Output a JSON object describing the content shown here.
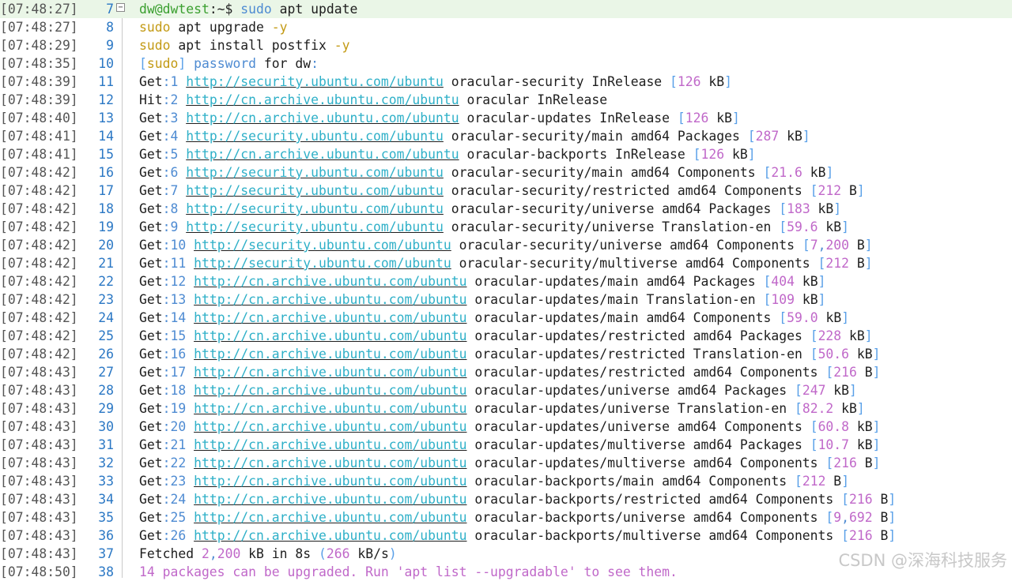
{
  "watermark": "CSDN @深海科技服务",
  "fold_icon": "minus-box-icon",
  "lines": [
    {
      "ts": "[07:48:27]",
      "n": "7",
      "active": true,
      "segs": [
        [
          "dw@dwtest",
          "green"
        ],
        [
          ":~$ ",
          "dark"
        ],
        [
          "sudo",
          "blue"
        ],
        [
          " apt update",
          "dark"
        ]
      ]
    },
    {
      "ts": "[07:48:27]",
      "n": "8",
      "segs": [
        [
          "sudo",
          "yellow"
        ],
        [
          " apt upgrade ",
          "dark"
        ],
        [
          "-y",
          "yellow"
        ]
      ]
    },
    {
      "ts": "[07:48:29]",
      "n": "9",
      "segs": [
        [
          "sudo",
          "yellow"
        ],
        [
          " apt install postfix ",
          "dark"
        ],
        [
          "-y",
          "yellow"
        ]
      ]
    },
    {
      "ts": "[07:48:35]",
      "n": "10",
      "segs": [
        [
          "[",
          "bracket"
        ],
        [
          "sudo",
          "yellow"
        ],
        [
          "] ",
          "bracket"
        ],
        [
          "password",
          "blue"
        ],
        [
          " for dw",
          "dark"
        ],
        [
          ":",
          "blue"
        ]
      ]
    },
    {
      "ts": "[07:48:39]",
      "n": "11",
      "segs": [
        [
          "Get",
          "dark"
        ],
        [
          ":1 ",
          "blue"
        ],
        [
          "http://security.ubuntu.com/ubuntu",
          "url"
        ],
        [
          " oracular-security InRelease ",
          "dark"
        ],
        [
          "[",
          "bracket"
        ],
        [
          "126",
          "num"
        ],
        [
          " kB",
          "dark"
        ],
        [
          "]",
          "bracket"
        ]
      ]
    },
    {
      "ts": "[07:48:39]",
      "n": "12",
      "segs": [
        [
          "Hit",
          "dark"
        ],
        [
          ":2 ",
          "blue"
        ],
        [
          "http://cn.archive.ubuntu.com/ubuntu",
          "url"
        ],
        [
          " oracular InRelease",
          "dark"
        ]
      ]
    },
    {
      "ts": "[07:48:40]",
      "n": "13",
      "segs": [
        [
          "Get",
          "dark"
        ],
        [
          ":3 ",
          "blue"
        ],
        [
          "http://cn.archive.ubuntu.com/ubuntu",
          "url"
        ],
        [
          " oracular-updates InRelease ",
          "dark"
        ],
        [
          "[",
          "bracket"
        ],
        [
          "126",
          "num"
        ],
        [
          " kB",
          "dark"
        ],
        [
          "]",
          "bracket"
        ]
      ]
    },
    {
      "ts": "[07:48:41]",
      "n": "14",
      "segs": [
        [
          "Get",
          "dark"
        ],
        [
          ":4 ",
          "blue"
        ],
        [
          "http://security.ubuntu.com/ubuntu",
          "url"
        ],
        [
          " oracular-security/main amd64 Packages ",
          "dark"
        ],
        [
          "[",
          "bracket"
        ],
        [
          "287",
          "num"
        ],
        [
          " kB",
          "dark"
        ],
        [
          "]",
          "bracket"
        ]
      ]
    },
    {
      "ts": "[07:48:41]",
      "n": "15",
      "segs": [
        [
          "Get",
          "dark"
        ],
        [
          ":5 ",
          "blue"
        ],
        [
          "http://cn.archive.ubuntu.com/ubuntu",
          "url"
        ],
        [
          " oracular-backports InRelease ",
          "dark"
        ],
        [
          "[",
          "bracket"
        ],
        [
          "126",
          "num"
        ],
        [
          " kB",
          "dark"
        ],
        [
          "]",
          "bracket"
        ]
      ]
    },
    {
      "ts": "[07:48:42]",
      "n": "16",
      "segs": [
        [
          "Get",
          "dark"
        ],
        [
          ":6 ",
          "blue"
        ],
        [
          "http://security.ubuntu.com/ubuntu",
          "url"
        ],
        [
          " oracular-security/main amd64 Components ",
          "dark"
        ],
        [
          "[",
          "bracket"
        ],
        [
          "21.6",
          "num"
        ],
        [
          " kB",
          "dark"
        ],
        [
          "]",
          "bracket"
        ]
      ]
    },
    {
      "ts": "[07:48:42]",
      "n": "17",
      "segs": [
        [
          "Get",
          "dark"
        ],
        [
          ":7 ",
          "blue"
        ],
        [
          "http://security.ubuntu.com/ubuntu",
          "url"
        ],
        [
          " oracular-security/restricted amd64 Components ",
          "dark"
        ],
        [
          "[",
          "bracket"
        ],
        [
          "212",
          "num"
        ],
        [
          " B",
          "dark"
        ],
        [
          "]",
          "bracket"
        ]
      ]
    },
    {
      "ts": "[07:48:42]",
      "n": "18",
      "segs": [
        [
          "Get",
          "dark"
        ],
        [
          ":8 ",
          "blue"
        ],
        [
          "http://security.ubuntu.com/ubuntu",
          "url"
        ],
        [
          " oracular-security/universe amd64 Packages ",
          "dark"
        ],
        [
          "[",
          "bracket"
        ],
        [
          "183",
          "num"
        ],
        [
          " kB",
          "dark"
        ],
        [
          "]",
          "bracket"
        ]
      ]
    },
    {
      "ts": "[07:48:42]",
      "n": "19",
      "segs": [
        [
          "Get",
          "dark"
        ],
        [
          ":9 ",
          "blue"
        ],
        [
          "http://security.ubuntu.com/ubuntu",
          "url"
        ],
        [
          " oracular-security/universe Translation-en ",
          "dark"
        ],
        [
          "[",
          "bracket"
        ],
        [
          "59.6",
          "num"
        ],
        [
          " kB",
          "dark"
        ],
        [
          "]",
          "bracket"
        ]
      ]
    },
    {
      "ts": "[07:48:42]",
      "n": "20",
      "segs": [
        [
          "Get",
          "dark"
        ],
        [
          ":10 ",
          "blue"
        ],
        [
          "http://security.ubuntu.com/ubuntu",
          "url"
        ],
        [
          " oracular-security/universe amd64 Components ",
          "dark"
        ],
        [
          "[",
          "bracket"
        ],
        [
          "7",
          "num"
        ],
        [
          ",",
          "blue"
        ],
        [
          "200",
          "num"
        ],
        [
          " B",
          "dark"
        ],
        [
          "]",
          "bracket"
        ]
      ]
    },
    {
      "ts": "[07:48:42]",
      "n": "21",
      "segs": [
        [
          "Get",
          "dark"
        ],
        [
          ":11 ",
          "blue"
        ],
        [
          "http://security.ubuntu.com/ubuntu",
          "url"
        ],
        [
          " oracular-security/multiverse amd64 Components ",
          "dark"
        ],
        [
          "[",
          "bracket"
        ],
        [
          "212",
          "num"
        ],
        [
          " B",
          "dark"
        ],
        [
          "]",
          "bracket"
        ]
      ]
    },
    {
      "ts": "[07:48:42]",
      "n": "22",
      "segs": [
        [
          "Get",
          "dark"
        ],
        [
          ":12 ",
          "blue"
        ],
        [
          "http://cn.archive.ubuntu.com/ubuntu",
          "url"
        ],
        [
          " oracular-updates/main amd64 Packages ",
          "dark"
        ],
        [
          "[",
          "bracket"
        ],
        [
          "404",
          "num"
        ],
        [
          " kB",
          "dark"
        ],
        [
          "]",
          "bracket"
        ]
      ]
    },
    {
      "ts": "[07:48:42]",
      "n": "23",
      "segs": [
        [
          "Get",
          "dark"
        ],
        [
          ":13 ",
          "blue"
        ],
        [
          "http://cn.archive.ubuntu.com/ubuntu",
          "url"
        ],
        [
          " oracular-updates/main Translation-en ",
          "dark"
        ],
        [
          "[",
          "bracket"
        ],
        [
          "109",
          "num"
        ],
        [
          " kB",
          "dark"
        ],
        [
          "]",
          "bracket"
        ]
      ]
    },
    {
      "ts": "[07:48:42]",
      "n": "24",
      "segs": [
        [
          "Get",
          "dark"
        ],
        [
          ":14 ",
          "blue"
        ],
        [
          "http://cn.archive.ubuntu.com/ubuntu",
          "url"
        ],
        [
          " oracular-updates/main amd64 Components ",
          "dark"
        ],
        [
          "[",
          "bracket"
        ],
        [
          "59.0",
          "num"
        ],
        [
          " kB",
          "dark"
        ],
        [
          "]",
          "bracket"
        ]
      ]
    },
    {
      "ts": "[07:48:42]",
      "n": "25",
      "segs": [
        [
          "Get",
          "dark"
        ],
        [
          ":15 ",
          "blue"
        ],
        [
          "http://cn.archive.ubuntu.com/ubuntu",
          "url"
        ],
        [
          " oracular-updates/restricted amd64 Packages ",
          "dark"
        ],
        [
          "[",
          "bracket"
        ],
        [
          "228",
          "num"
        ],
        [
          " kB",
          "dark"
        ],
        [
          "]",
          "bracket"
        ]
      ]
    },
    {
      "ts": "[07:48:42]",
      "n": "26",
      "segs": [
        [
          "Get",
          "dark"
        ],
        [
          ":16 ",
          "blue"
        ],
        [
          "http://cn.archive.ubuntu.com/ubuntu",
          "url"
        ],
        [
          " oracular-updates/restricted Translation-en ",
          "dark"
        ],
        [
          "[",
          "bracket"
        ],
        [
          "50.6",
          "num"
        ],
        [
          " kB",
          "dark"
        ],
        [
          "]",
          "bracket"
        ]
      ]
    },
    {
      "ts": "[07:48:43]",
      "n": "27",
      "segs": [
        [
          "Get",
          "dark"
        ],
        [
          ":17 ",
          "blue"
        ],
        [
          "http://cn.archive.ubuntu.com/ubuntu",
          "url"
        ],
        [
          " oracular-updates/restricted amd64 Components ",
          "dark"
        ],
        [
          "[",
          "bracket"
        ],
        [
          "216",
          "num"
        ],
        [
          " B",
          "dark"
        ],
        [
          "]",
          "bracket"
        ]
      ]
    },
    {
      "ts": "[07:48:43]",
      "n": "28",
      "segs": [
        [
          "Get",
          "dark"
        ],
        [
          ":18 ",
          "blue"
        ],
        [
          "http://cn.archive.ubuntu.com/ubuntu",
          "url"
        ],
        [
          " oracular-updates/universe amd64 Packages ",
          "dark"
        ],
        [
          "[",
          "bracket"
        ],
        [
          "247",
          "num"
        ],
        [
          " kB",
          "dark"
        ],
        [
          "]",
          "bracket"
        ]
      ]
    },
    {
      "ts": "[07:48:43]",
      "n": "29",
      "segs": [
        [
          "Get",
          "dark"
        ],
        [
          ":19 ",
          "blue"
        ],
        [
          "http://cn.archive.ubuntu.com/ubuntu",
          "url"
        ],
        [
          " oracular-updates/universe Translation-en ",
          "dark"
        ],
        [
          "[",
          "bracket"
        ],
        [
          "82.2",
          "num"
        ],
        [
          " kB",
          "dark"
        ],
        [
          "]",
          "bracket"
        ]
      ]
    },
    {
      "ts": "[07:48:43]",
      "n": "30",
      "segs": [
        [
          "Get",
          "dark"
        ],
        [
          ":20 ",
          "blue"
        ],
        [
          "http://cn.archive.ubuntu.com/ubuntu",
          "url"
        ],
        [
          " oracular-updates/universe amd64 Components ",
          "dark"
        ],
        [
          "[",
          "bracket"
        ],
        [
          "60.8",
          "num"
        ],
        [
          " kB",
          "dark"
        ],
        [
          "]",
          "bracket"
        ]
      ]
    },
    {
      "ts": "[07:48:43]",
      "n": "31",
      "segs": [
        [
          "Get",
          "dark"
        ],
        [
          ":21 ",
          "blue"
        ],
        [
          "http://cn.archive.ubuntu.com/ubuntu",
          "url"
        ],
        [
          " oracular-updates/multiverse amd64 Packages ",
          "dark"
        ],
        [
          "[",
          "bracket"
        ],
        [
          "10.7",
          "num"
        ],
        [
          " kB",
          "dark"
        ],
        [
          "]",
          "bracket"
        ]
      ]
    },
    {
      "ts": "[07:48:43]",
      "n": "32",
      "segs": [
        [
          "Get",
          "dark"
        ],
        [
          ":22 ",
          "blue"
        ],
        [
          "http://cn.archive.ubuntu.com/ubuntu",
          "url"
        ],
        [
          " oracular-updates/multiverse amd64 Components ",
          "dark"
        ],
        [
          "[",
          "bracket"
        ],
        [
          "216",
          "num"
        ],
        [
          " B",
          "dark"
        ],
        [
          "]",
          "bracket"
        ]
      ]
    },
    {
      "ts": "[07:48:43]",
      "n": "33",
      "segs": [
        [
          "Get",
          "dark"
        ],
        [
          ":23 ",
          "blue"
        ],
        [
          "http://cn.archive.ubuntu.com/ubuntu",
          "url"
        ],
        [
          " oracular-backports/main amd64 Components ",
          "dark"
        ],
        [
          "[",
          "bracket"
        ],
        [
          "212",
          "num"
        ],
        [
          " B",
          "dark"
        ],
        [
          "]",
          "bracket"
        ]
      ]
    },
    {
      "ts": "[07:48:43]",
      "n": "34",
      "segs": [
        [
          "Get",
          "dark"
        ],
        [
          ":24 ",
          "blue"
        ],
        [
          "http://cn.archive.ubuntu.com/ubuntu",
          "url"
        ],
        [
          " oracular-backports/restricted amd64 Components ",
          "dark"
        ],
        [
          "[",
          "bracket"
        ],
        [
          "216",
          "num"
        ],
        [
          " B",
          "dark"
        ],
        [
          "]",
          "bracket"
        ]
      ]
    },
    {
      "ts": "[07:48:43]",
      "n": "35",
      "segs": [
        [
          "Get",
          "dark"
        ],
        [
          ":25 ",
          "blue"
        ],
        [
          "http://cn.archive.ubuntu.com/ubuntu",
          "url"
        ],
        [
          " oracular-backports/universe amd64 Components ",
          "dark"
        ],
        [
          "[",
          "bracket"
        ],
        [
          "9",
          "num"
        ],
        [
          ",",
          "blue"
        ],
        [
          "692",
          "num"
        ],
        [
          " B",
          "dark"
        ],
        [
          "]",
          "bracket"
        ]
      ]
    },
    {
      "ts": "[07:48:43]",
      "n": "36",
      "segs": [
        [
          "Get",
          "dark"
        ],
        [
          ":26 ",
          "blue"
        ],
        [
          "http://cn.archive.ubuntu.com/ubuntu",
          "url"
        ],
        [
          " oracular-backports/multiverse amd64 Components ",
          "dark"
        ],
        [
          "[",
          "bracket"
        ],
        [
          "216",
          "num"
        ],
        [
          " B",
          "dark"
        ],
        [
          "]",
          "bracket"
        ]
      ]
    },
    {
      "ts": "[07:48:43]",
      "n": "37",
      "segs": [
        [
          "Fetched ",
          "dark"
        ],
        [
          "2",
          "num"
        ],
        [
          ",",
          "blue"
        ],
        [
          "200",
          "num"
        ],
        [
          " kB in 8s ",
          "dark"
        ],
        [
          "(",
          "bracket"
        ],
        [
          "266",
          "num"
        ],
        [
          " kB/s",
          "dark"
        ],
        [
          ")",
          "bracket"
        ]
      ]
    },
    {
      "ts": "[07:48:50]",
      "n": "38",
      "segs": [
        [
          "14 packages can be upgraded. Run 'apt list --upgradable' to see them.",
          "magenta"
        ]
      ]
    }
  ]
}
